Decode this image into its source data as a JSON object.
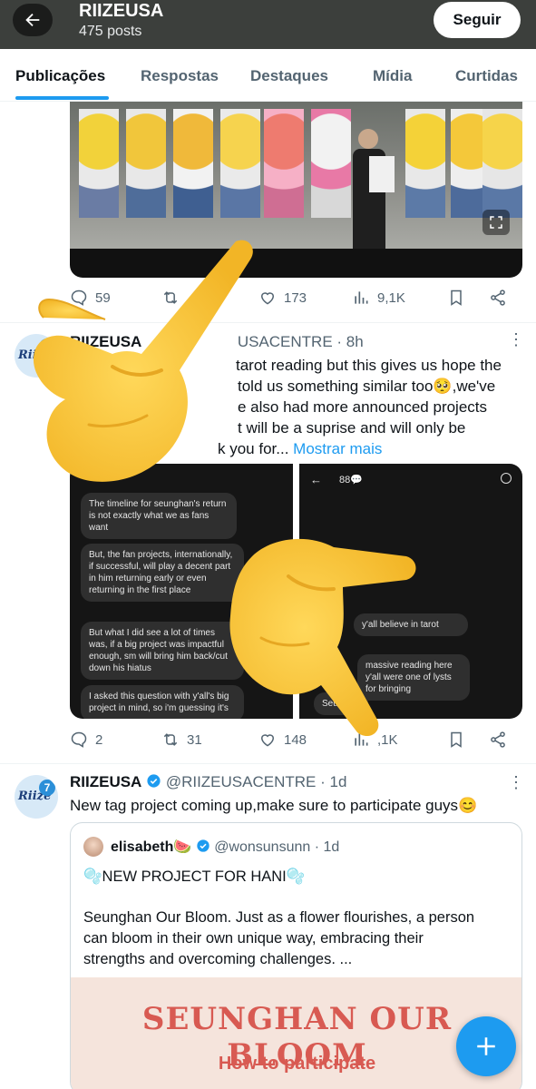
{
  "header": {
    "account_name": "RIIZEUSA",
    "posts_count": "475 posts",
    "follow_label": "Seguir"
  },
  "tabs": [
    {
      "label": "Publicações",
      "active": true
    },
    {
      "label": "Respostas"
    },
    {
      "label": "Destaques"
    },
    {
      "label": "Mídia"
    },
    {
      "label": "Curtidas"
    }
  ],
  "post1": {
    "stats": {
      "replies": "59",
      "likes": "173",
      "views": "9,1K"
    }
  },
  "post2": {
    "name": "RIIZEUSA",
    "handle_visible": "USACENTRE",
    "time": "· 8h",
    "lines": [
      "tarot reading but this gives us hope the",
      "told us something similar too🥺,we've",
      "e also had more announced projects",
      "t will be a suprise and will only be",
      "k you for..."
    ],
    "more_link": "Mostrar mais",
    "left_bubbles": [
      "The timeline for seunghan's return is not exactly what we as fans want",
      "But, the fan projects, internationally, if successful, will play a decent part in him returning early or even returning in the first place",
      "But what I did see a lot of times was, if a big project was impactful enough, sm will bring him back/cut down his hiatus",
      "I asked this question with y'all's big project in mind, so i'm guessing it's"
    ],
    "right_bubbles": [
      "y'all believe in tarot",
      "massive reading here y'all were one of lysts for bringing",
      "Seung"
    ],
    "right_title": "88💬",
    "stats": {
      "replies": "2",
      "reposts": "31",
      "likes": "148",
      "views": ",1K"
    }
  },
  "post3": {
    "name": "RIIZEUSA",
    "handle": "@RIIZEUSACENTRE",
    "time": "· 1d",
    "text": "New tag project coming up,make sure to participate guys😊",
    "quote": {
      "name": "elisabeth🍉",
      "handle": "@wonsunsunn",
      "time": "· 1d",
      "title_line": "🫧NEW PROJECT FOR HANI🫧",
      "body_lines": [
        "Seunghan Our Bloom. Just as a flower flourishes, a person",
        "can bloom in their own unique way, embracing their",
        "strengths and overcoming challenges. ..."
      ],
      "poster_title": "SEUNGHAN OUR BLOOM",
      "poster_sub": "How to participate"
    }
  },
  "avatar_logo": "Riize",
  "avatar_badge": "7",
  "colors": {
    "accent": "#1d9bf0",
    "header_bg": "#3c3f3c",
    "muted": "#536471",
    "poster_red": "#d85a52"
  },
  "icons": [
    "back-arrow-icon",
    "reply-icon",
    "repost-icon",
    "like-icon",
    "views-icon",
    "bookmark-icon",
    "share-icon",
    "more-icon",
    "verified-icon",
    "expand-icon",
    "plus-icon",
    "pointing-hand-emoji"
  ]
}
